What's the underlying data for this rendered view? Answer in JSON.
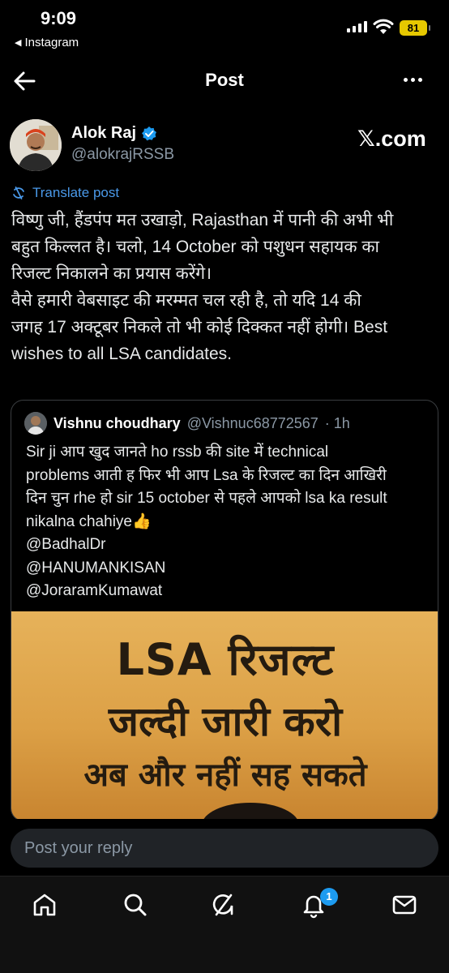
{
  "status_bar": {
    "time": "9:09",
    "back_app": "Instagram",
    "battery": "81"
  },
  "header": {
    "title": "Post"
  },
  "post": {
    "author_name": "Alok Raj",
    "author_handle": "@alokrajRSSB",
    "source_label": "𝕏.com",
    "translate_label": "Translate post",
    "text_lines": [
      "विष्णु जी, हैंडपंप मत उखाड़ो, Rajasthan में पानी की अभी भी",
      "बहुत किल्लत है। चलो, 14 October को पशुधन सहायक का",
      "रिजल्ट निकालने का प्रयास करेंगे।",
      "वैसे हमारी वेबसाइट की मरम्मत चल रही है, तो यदि 14 की",
      "जगह 17 अक्टूबर निकले तो भी कोई दिक्कत नहीं होगी।  Best",
      "wishes to all LSA candidates."
    ]
  },
  "quote": {
    "author_name": "Vishnu choudhary",
    "author_handle": "@Vishnuc68772567",
    "time": "· 1h",
    "text_lines": [
      "Sir ji आप खुद जानते ho rssb की site में technical",
      "problems आती ह फिर भी आप Lsa के रिजल्ट का दिन आखिरी",
      "दिन चुन rhe हो sir 15 october से पहले आपको lsa ka result",
      "nikalna chahiye👍",
      "@BadhalDr",
      "@HANUMANKISAN",
      "@JoraramKumawat"
    ],
    "image_text": {
      "line1": "LSA रिजल्ट",
      "line2": "जल्दी जारी करो",
      "line3": "अब और नहीं सह सकते"
    }
  },
  "reply": {
    "placeholder": "Post your reply"
  },
  "nav": {
    "notification_count": "1",
    "icons": [
      "home-icon",
      "search-icon",
      "grok-icon",
      "notifications-icon",
      "messages-icon"
    ]
  },
  "colors": {
    "background": "#000000",
    "accent": "#1d9bf0",
    "link": "#4a99e9",
    "muted": "#8b98a5",
    "battery": "#e6c800"
  }
}
